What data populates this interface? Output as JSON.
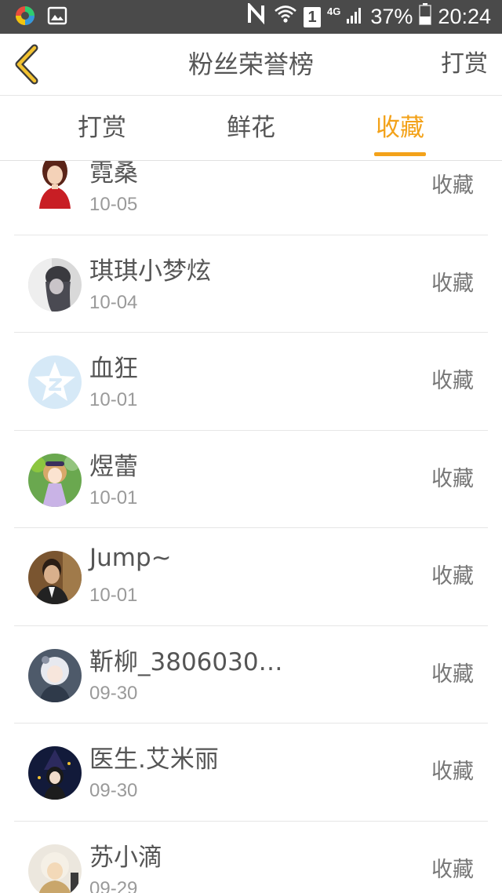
{
  "status_bar": {
    "network_label": "4G",
    "sim_number": "1",
    "battery": "37%",
    "time": "20:24",
    "icons": [
      "app-store-icon",
      "image-icon",
      "nfc-icon",
      "wifi-icon",
      "sim-icon",
      "signal-icon",
      "battery-icon"
    ]
  },
  "nav": {
    "back_icon": "chevron-left-icon",
    "title": "粉丝荣誉榜",
    "action_label": "打赏"
  },
  "tabs": [
    {
      "label": "打赏",
      "active": false
    },
    {
      "label": "鲜花",
      "active": false
    },
    {
      "label": "收藏",
      "active": true
    }
  ],
  "colors": {
    "accent": "#f3a21a",
    "status_bar_bg": "#4a4a4a",
    "text_primary": "#555555",
    "text_secondary": "#9a9a9a",
    "divider": "#e6e6e6"
  },
  "list": {
    "items": [
      {
        "name": "霓桑",
        "date": "10-05",
        "action": "收藏"
      },
      {
        "name": "琪琪小梦炫",
        "date": "10-04",
        "action": "收藏"
      },
      {
        "name": "血狂",
        "date": "10-01",
        "action": "收藏"
      },
      {
        "name": "煜蕾",
        "date": "10-01",
        "action": "收藏"
      },
      {
        "name": "Jump~",
        "date": "10-01",
        "action": "收藏"
      },
      {
        "name": "靳柳_3806030…",
        "date": "09-30",
        "action": "收藏"
      },
      {
        "name": "医生.艾米丽",
        "date": "09-30",
        "action": "收藏"
      },
      {
        "name": "苏小滴",
        "date": "09-29",
        "action": "收藏"
      }
    ]
  }
}
